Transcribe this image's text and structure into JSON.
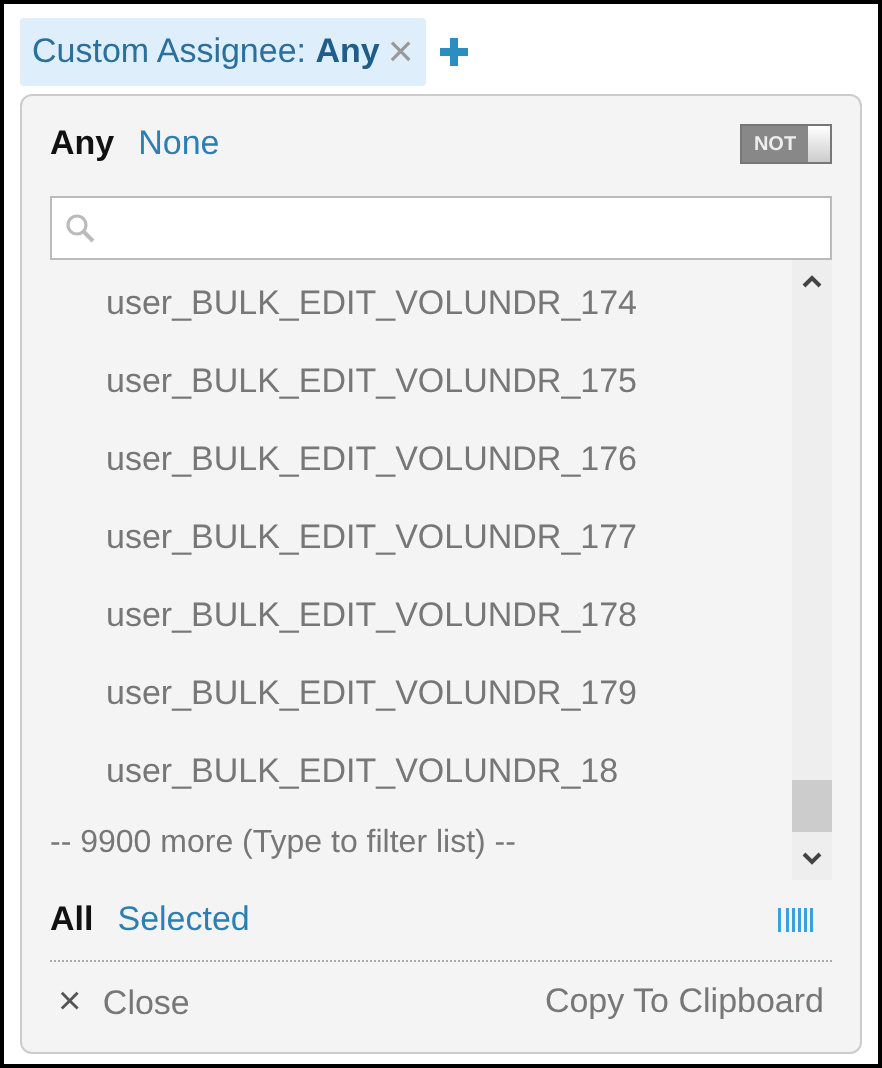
{
  "filter_chip": {
    "label": "Custom Assignee: ",
    "value": "Any",
    "close_glyph": "×"
  },
  "mode_tabs": [
    {
      "label": "Any",
      "selected": true
    },
    {
      "label": "None",
      "selected": false
    }
  ],
  "not_toggle": {
    "label": "NOT",
    "on": false
  },
  "items": [
    "user_BULK_EDIT_VOLUNDR_174",
    "user_BULK_EDIT_VOLUNDR_175",
    "user_BULK_EDIT_VOLUNDR_176",
    "user_BULK_EDIT_VOLUNDR_177",
    "user_BULK_EDIT_VOLUNDR_178",
    "user_BULK_EDIT_VOLUNDR_179",
    "user_BULK_EDIT_VOLUNDR_18"
  ],
  "more_note": "-- 9900 more (Type to filter list) --",
  "view_tabs": [
    {
      "label": "All",
      "selected": true
    },
    {
      "label": "Selected",
      "selected": false
    }
  ],
  "footer": {
    "close_glyph": "×",
    "close": "Close",
    "copy": "Copy To Clipboard"
  }
}
